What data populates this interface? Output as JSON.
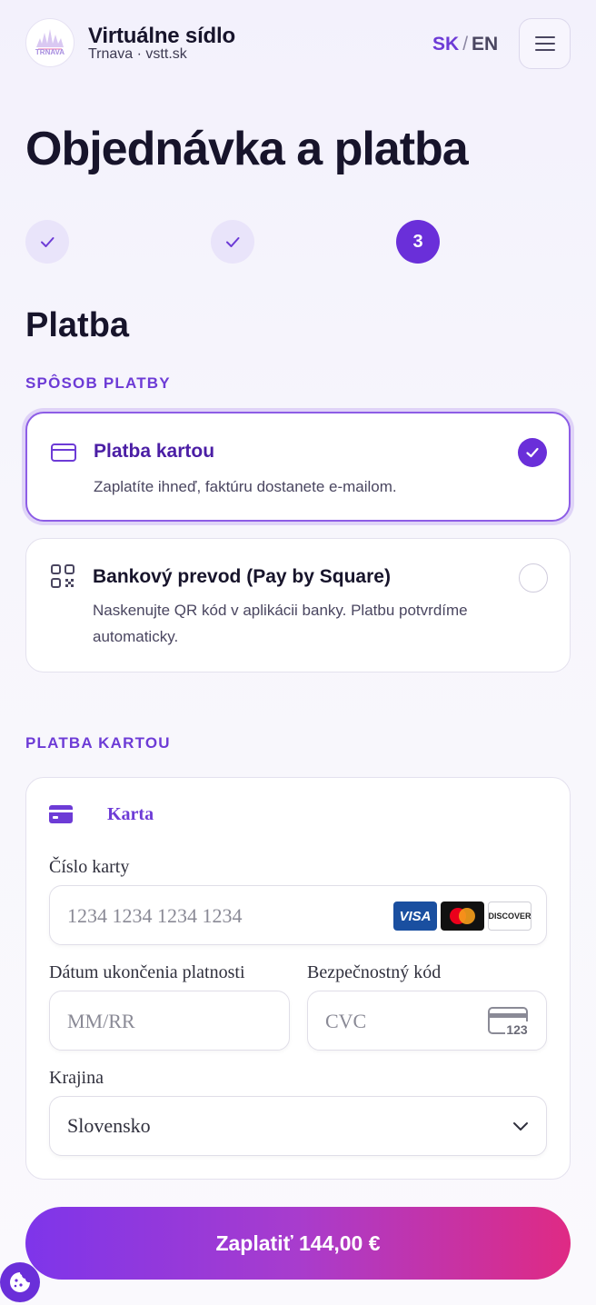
{
  "header": {
    "brand_name": "Virtuálne sídlo",
    "brand_sub": "Trnava · vstt.sk",
    "logo_text": "TRNAVA",
    "lang_sk": "SK",
    "lang_sep": "/",
    "lang_en": "EN",
    "menu_icon": "hamburger-icon"
  },
  "page_title": "Objednávka a platba",
  "stepper": {
    "steps": [
      {
        "state": "done",
        "label": "✓"
      },
      {
        "state": "done",
        "label": "✓"
      },
      {
        "state": "active",
        "label": "3"
      }
    ]
  },
  "section_title": "Platba",
  "payment_method": {
    "heading": "SPÔSOB PLATBY",
    "options": [
      {
        "title": "Platba kartou",
        "desc": "Zaplatíte ihneď, faktúru dostanete e-mailom.",
        "selected": true,
        "icon": "credit-card-icon"
      },
      {
        "title": "Bankový prevod (Pay by Square)",
        "desc": "Naskenujte QR kód v aplikácii banky. Platbu potvrdíme automaticky.",
        "selected": false,
        "icon": "qr-code-icon"
      }
    ]
  },
  "card_payment": {
    "heading": "PLATBA KARTOU",
    "tab_label": "Karta",
    "card_number_label": "Číslo karty",
    "card_number_placeholder": "1234 1234 1234 1234",
    "card_brands": [
      "VISA",
      "Mastercard",
      "DISCOVER"
    ],
    "expiry_label": "Dátum ukončenia platnosti",
    "expiry_placeholder": "MM/RR",
    "cvc_label": "Bezpečnostný kód",
    "cvc_placeholder": "CVC",
    "cvc_icon_text": "123",
    "country_label": "Krajina",
    "country_value": "Slovensko"
  },
  "pay_button": "Zaplatiť 144,00 €",
  "colors": {
    "accent": "#6a2fd9",
    "gradient_start": "#7e35ea",
    "gradient_end": "#df2a84"
  }
}
